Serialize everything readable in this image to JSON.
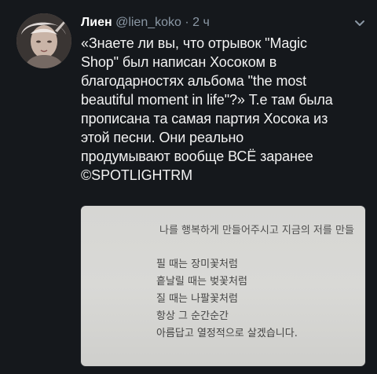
{
  "tweet": {
    "author": {
      "name": "Лиен",
      "handle": "@lien_koko",
      "separator": "·",
      "time": "2 ч"
    },
    "text": "«Знаете ли вы, что отрывок \"Magic\nShop\" был написан Хосоком в\nблагодарностях альбома \"the most\nbeautiful moment in life\"?» Т.е там была\nпрописана та самая партия Хосока из\nэтой песни. Они реально\nпродумывают вообще ВСЁ заранее\n©SPOTLIGHTRM",
    "image": {
      "title": "나를 행복하게 만들어주시고 지금의 저를 만들",
      "lines": [
        "필 때는 장미꽃처럼",
        "흩날릴 때는 벚꽃처럼",
        "질 때는 나팔꽃처럼",
        "항상 그 순간순간",
        "아름답고 열정적으로 살겠습니다."
      ]
    }
  },
  "icons": {
    "menu": "chevron-down-icon"
  },
  "colors": {
    "background": "#15181c",
    "muted_text": "#8b98a5",
    "text": "#ffffff",
    "paper": "#d8d8d5",
    "paper_text": "#444444"
  }
}
